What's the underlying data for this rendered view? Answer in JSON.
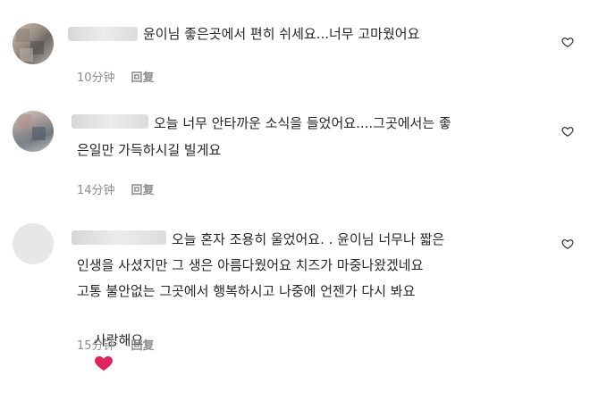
{
  "comments": [
    {
      "text": "윤이님 좋은곳에서 편히 쉬세요...너무 고마웠어요",
      "time": "10分钟",
      "reply_label": "回复",
      "like_icon": "heart-outline-icon"
    },
    {
      "text_line1": "오늘 너무 안타까운 소식을 들었어요....그곳에서는 좋",
      "text_line2": "은일만 가득하시길 빌게요",
      "time": "14分钟",
      "reply_label": "回复",
      "like_icon": "heart-outline-icon"
    },
    {
      "text_line1": "오늘 혼자 조용히 울었어요. . 윤이님 너무나 짧은",
      "text_line2": "인생을 사셨지만 그 생은 아름다웠어요 치즈가 마중나왔겠네요",
      "text_line3": "고통 불안없는 그곳에서 행복하시고 나중에 언젠가 다시 봐요",
      "text_line4": "사랑해요",
      "time": "15分钟",
      "reply_label": "回复",
      "like_icon": "heart-outline-icon"
    }
  ],
  "colors": {
    "text": "#262626",
    "meta": "#8e8e8e",
    "heart_emoji": "#e0245e"
  }
}
